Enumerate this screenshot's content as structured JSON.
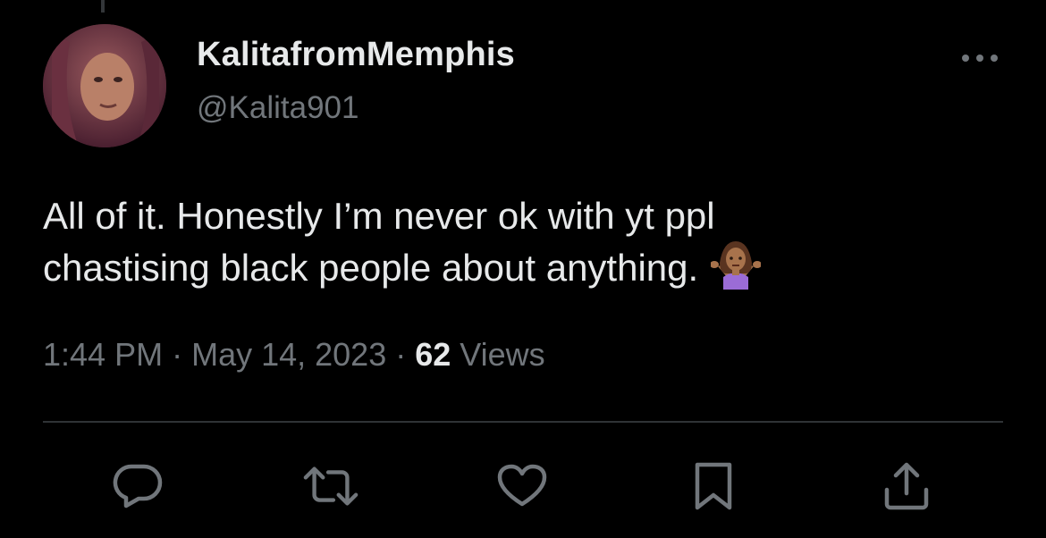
{
  "user": {
    "display_name": "KalitafromMemphis",
    "handle": "@Kalita901"
  },
  "tweet": {
    "lines": [
      "All of it. Honestly I’m never ok with yt ppl",
      "chastising black people about anything."
    ],
    "emoji": "person-shrugging-emoji"
  },
  "meta": {
    "time": "1:44 PM",
    "separator1": " · ",
    "date": "May 14, 2023",
    "separator2": " · ",
    "views_count": "62",
    "views_label": " Views"
  },
  "actions": {
    "reply": "reply-icon",
    "retweet": "retweet-icon",
    "like": "heart-icon",
    "bookmark": "bookmark-icon",
    "share": "share-icon"
  },
  "colors": {
    "background": "#000000",
    "text_primary": "#e7e9ea",
    "text_secondary": "#71767b",
    "divider": "#2f3336"
  }
}
